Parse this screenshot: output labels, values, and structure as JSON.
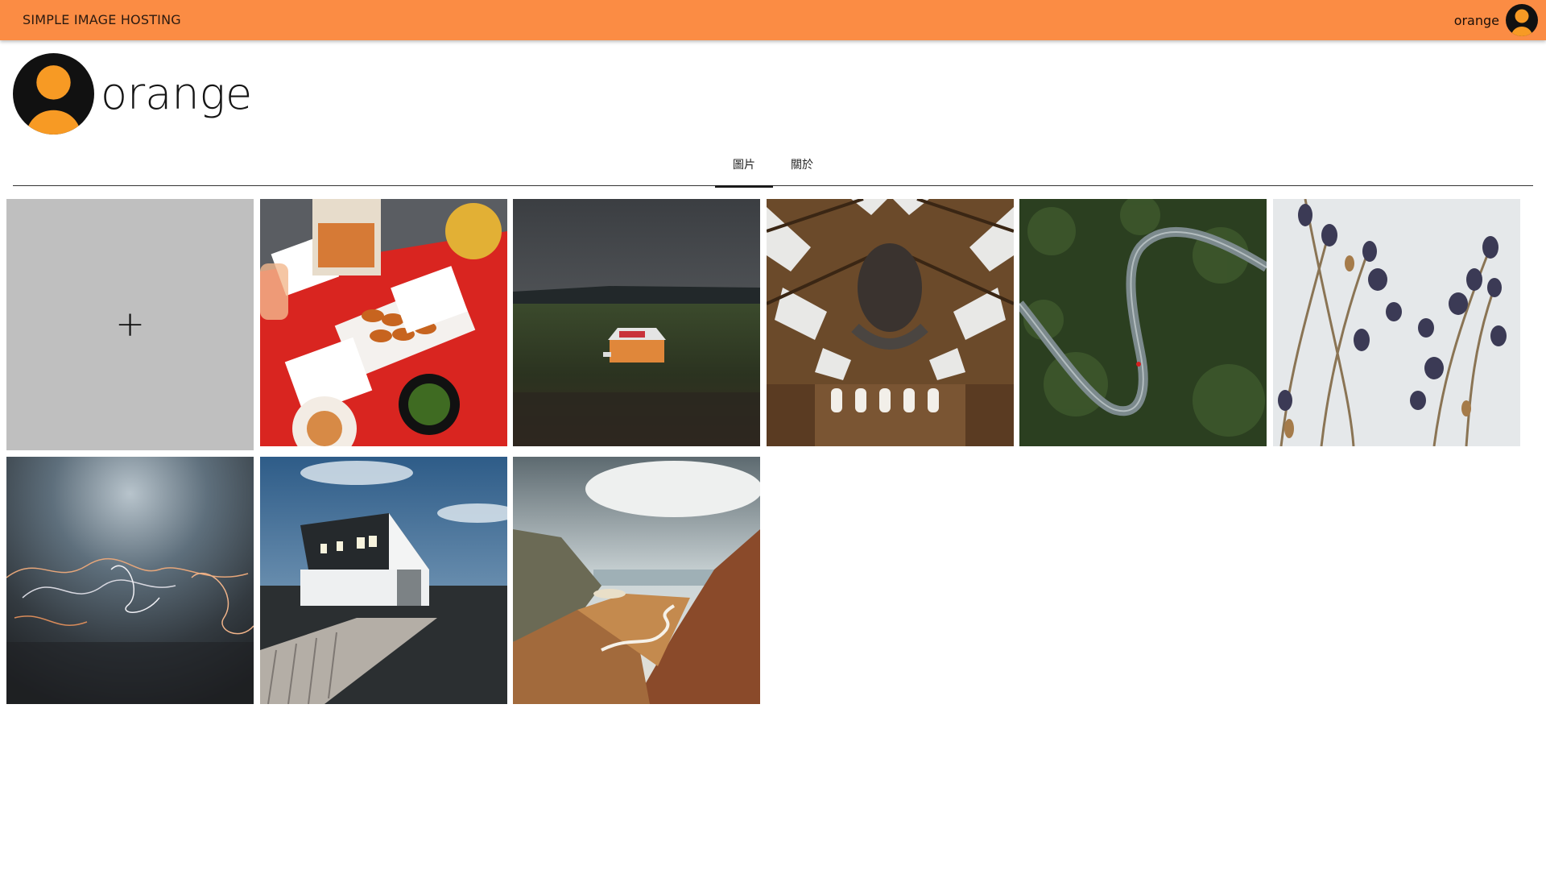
{
  "header": {
    "brand": "SIMPLE IMAGE HOSTING",
    "username": "orange",
    "bar_color": "#fb8c44"
  },
  "profile": {
    "name": "orange",
    "avatar_icon": "user-avatar-icon"
  },
  "tabs": [
    {
      "label": "圖片",
      "active": true
    },
    {
      "label": "關於",
      "active": false
    }
  ],
  "gallery": {
    "add_label": "+",
    "images": [
      {
        "subject": "food-table"
      },
      {
        "subject": "house-landscape"
      },
      {
        "subject": "museum-hall"
      },
      {
        "subject": "winding-road-forest"
      },
      {
        "subject": "lavender-flowers"
      },
      {
        "subject": "light-trails-ocean"
      },
      {
        "subject": "white-barn"
      },
      {
        "subject": "mountain-valley"
      }
    ]
  }
}
